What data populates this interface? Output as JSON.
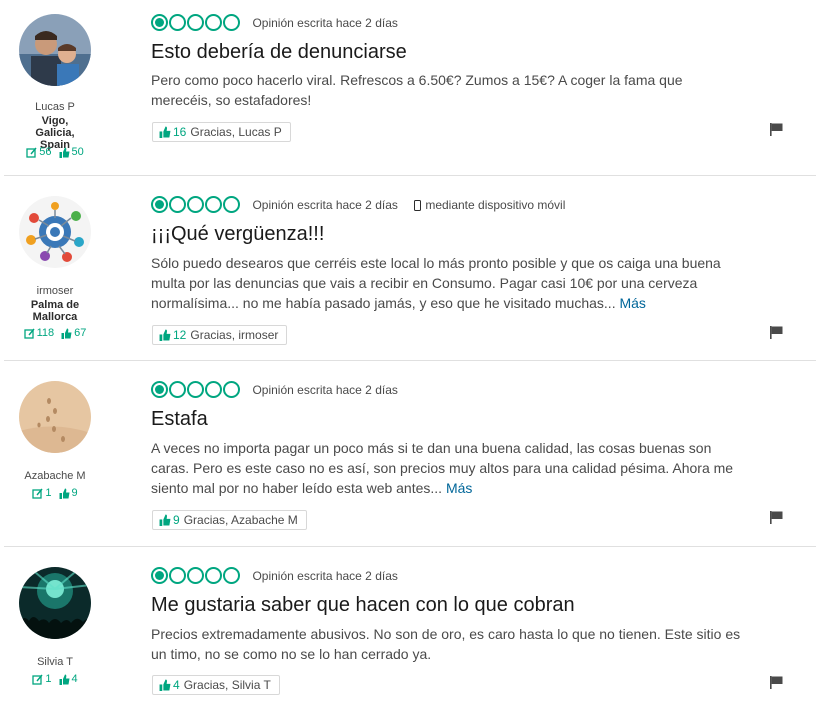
{
  "reviews": [
    {
      "member_name": "Lucas P",
      "member_location": "Vigo, Galicia, Spain",
      "reviews_count": "56",
      "helpful_count": "50",
      "rating": 1,
      "date_text": "Opinión escrita hace 2 días",
      "mobile_text": "",
      "title": "Esto debería de denunciarse",
      "body": "Pero como poco hacerlo viral. Refrescos a 6.50€? Zumos a 15€? A coger la fama que merecéis, so estafadores!",
      "more_label": "",
      "thanks_count": "16",
      "thanks_label": "Gracias, Lucas P"
    },
    {
      "member_name": "irmoser",
      "member_location": "Palma de Mallorca",
      "reviews_count": "118",
      "helpful_count": "67",
      "rating": 1,
      "date_text": "Opinión escrita hace 2 días",
      "mobile_text": "mediante dispositivo móvil",
      "title": "¡¡¡Qué vergüenza!!!",
      "body": "Sólo puedo desearos que cerréis este local lo más pronto posible y que os caiga una buena multa por las denuncias que vais a recibir en Consumo. Pagar casi 10€ por una cerveza normalísima... no me había pasado jamás, y eso que he visitado muchas...",
      "more_label": "Más",
      "thanks_count": "12",
      "thanks_label": "Gracias, irmoser"
    },
    {
      "member_name": "Azabache M",
      "member_location": "",
      "reviews_count": "1",
      "helpful_count": "9",
      "rating": 1,
      "date_text": "Opinión escrita hace 2 días",
      "mobile_text": "",
      "title": "Estafa",
      "body": "A veces no importa pagar un poco más si te dan una buena calidad, las cosas buenas son caras. Pero es este caso no es así, son precios muy altos para una calidad pésima. Ahora me siento mal por no haber leído esta web antes...",
      "more_label": "Más",
      "thanks_count": "9",
      "thanks_label": "Gracias, Azabache M"
    },
    {
      "member_name": "Silvia T",
      "member_location": "",
      "reviews_count": "1",
      "helpful_count": "4",
      "rating": 1,
      "date_text": "Opinión escrita hace 2 días",
      "mobile_text": "",
      "title": "Me gustaria saber que hacen con lo que cobran",
      "body": "Precios extremadamente abusivos. No son de oro, es caro hasta lo que no tienen. Este sitio es un timo, no se como no se lo han cerrado ya.",
      "more_label": "",
      "thanks_count": "4",
      "thanks_label": "Gracias, Silvia T"
    }
  ],
  "colors": {
    "accent": "#00a680",
    "link": "#006699",
    "text": "#4a4a4a",
    "title": "#1a1a1a",
    "divider": "#e0e0e0"
  },
  "icons": {
    "rating_bubble": "bubble-icon",
    "reviews": "review-count-icon",
    "helpful": "thumbs-up-icon",
    "mobile": "phone-icon",
    "report": "flag-icon"
  }
}
